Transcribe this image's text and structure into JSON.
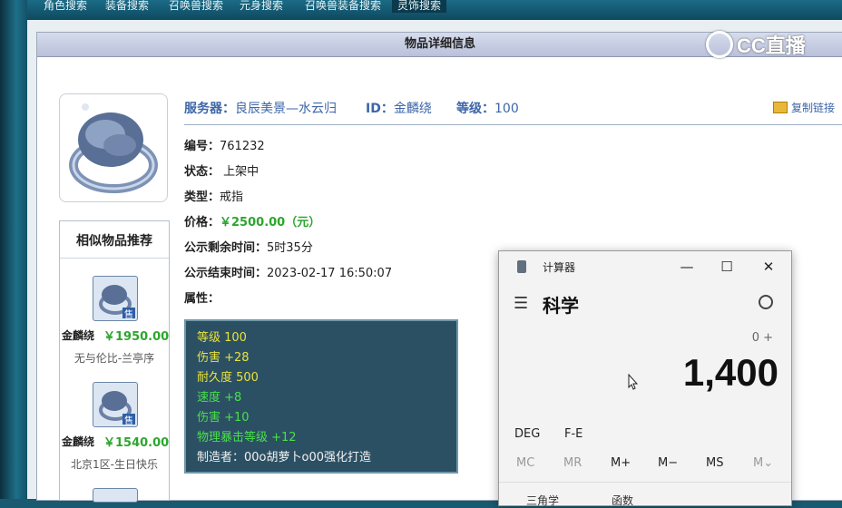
{
  "nav": {
    "tabs": [
      "角色搜索",
      "装备搜索",
      "召唤兽搜索",
      "元身搜索",
      "召唤兽装备搜索",
      "灵饰搜索"
    ],
    "active_tab": 5
  },
  "panel": {
    "title": "物品详细信息"
  },
  "watermark": {
    "text": "CC直播"
  },
  "server_line": {
    "server_label": "服务器：",
    "server_value": "良辰美景—水云归",
    "id_label": "ID：",
    "id_value": "金麟绕",
    "level_label": "等级：",
    "level_value": "100"
  },
  "copy_link": {
    "label": "复制链接"
  },
  "details": {
    "number_label": "编号：",
    "number_value": "761232",
    "status_label": "状态：",
    "status_value": "上架中",
    "type_label": "类型：",
    "type_value": "戒指",
    "price_label": "价格：",
    "price_value": "￥2500.00（元）",
    "remaining_label": "公示剩余时间：",
    "remaining_value": "5时35分",
    "end_label": "公示结束时间：",
    "end_value": "2023-02-17 16:50:07",
    "attr_label": "属性："
  },
  "attributes": [
    {
      "text": "等级 100",
      "color": "#e7e23c"
    },
    {
      "text": "伤害 +28",
      "color": "#e7e23c"
    },
    {
      "text": "耐久度 500",
      "color": "#e7e23c"
    },
    {
      "text": "速度 +8",
      "color": "#48e14a"
    },
    {
      "text": "伤害 +10",
      "color": "#48e14a"
    },
    {
      "text": "物理暴击等级 +12",
      "color": "#48e14a"
    },
    {
      "text": "制造者：00o胡萝卜o00强化打造",
      "color": "#f1f1f1"
    }
  ],
  "recommend": {
    "title": "相似物品推荐",
    "items": [
      {
        "name": "金麟绕",
        "price": "￥1950.00",
        "seller": "无与伦比-兰亭序",
        "badge": "售"
      },
      {
        "name": "金麟绕",
        "price": "￥1540.00",
        "seller": "北京1区-生日快乐",
        "badge": "售"
      }
    ]
  },
  "calculator": {
    "title": "计算器",
    "mode": "科学",
    "expression": "0 +",
    "display": "1,400",
    "row1": [
      "DEG",
      "F-E"
    ],
    "memory": [
      "MC",
      "MR",
      "M+",
      "M−",
      "MS",
      "M⌄"
    ],
    "functions": [
      "三角学",
      "函数"
    ]
  }
}
